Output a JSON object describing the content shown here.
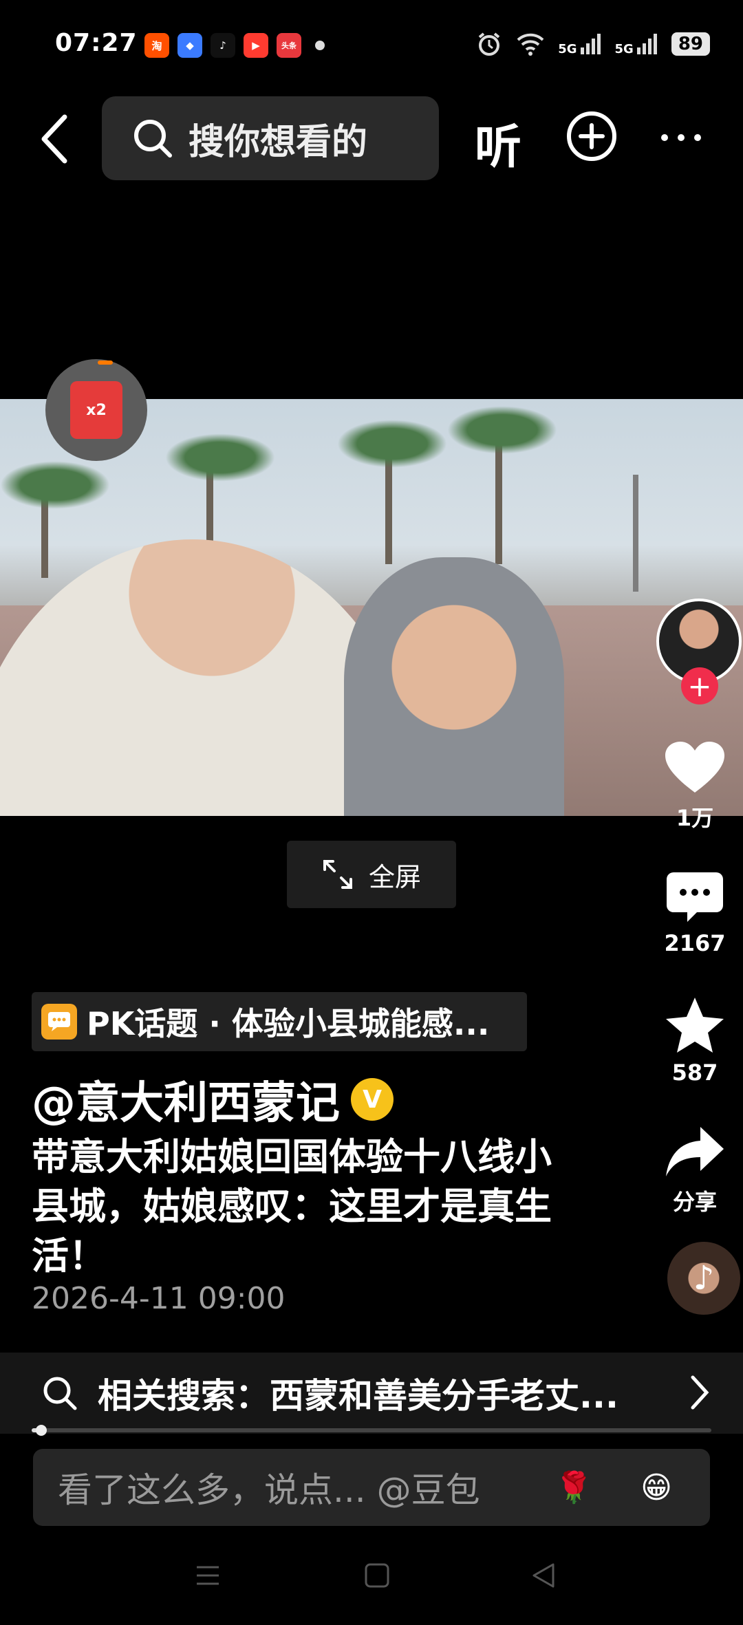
{
  "status_bar": {
    "time": "07:27",
    "apps": [
      {
        "name": "taobao-icon",
        "label": "淘",
        "color": "#ff5000"
      },
      {
        "name": "browser-icon",
        "label": "◆",
        "color": "#3b7bff"
      },
      {
        "name": "tiktok-icon",
        "label": "♪",
        "color": "#111111"
      },
      {
        "name": "video-app-icon",
        "label": "▶",
        "color": "#ff3b30"
      },
      {
        "name": "toutiao-icon",
        "label": "头条",
        "color": "#e8383d"
      }
    ],
    "signal_1": "5G",
    "signal_2": "5G",
    "battery": "89"
  },
  "header": {
    "search_placeholder": "搜你想看的",
    "listen_label": "听"
  },
  "video": {
    "fullscreen_label": "全屏",
    "packet_label": "x2"
  },
  "rail": {
    "likes": "1万",
    "comments": "2167",
    "favorites": "587",
    "share_label": "分享"
  },
  "caption": {
    "topic": "PK话题 · 体验小县城能感...",
    "author": "@意大利西蒙记",
    "verified_label": "V",
    "description": "带意大利姑娘回国体验十八线小县城，姑娘感叹：这里才是真生活！",
    "date": "2026-4-11 09:00"
  },
  "related": {
    "text": "相关搜索：西蒙和善美分手老丈..."
  },
  "progress": {
    "fraction": 0.01
  },
  "comment_box": {
    "placeholder": "看了这么多，说点... @豆包",
    "emoji_1": "🌹",
    "emoji_2": "😁"
  },
  "colors": {
    "accent_red": "#f02d4c",
    "verified_yellow": "#f7c21a",
    "topic_orange": "#f5a623"
  }
}
